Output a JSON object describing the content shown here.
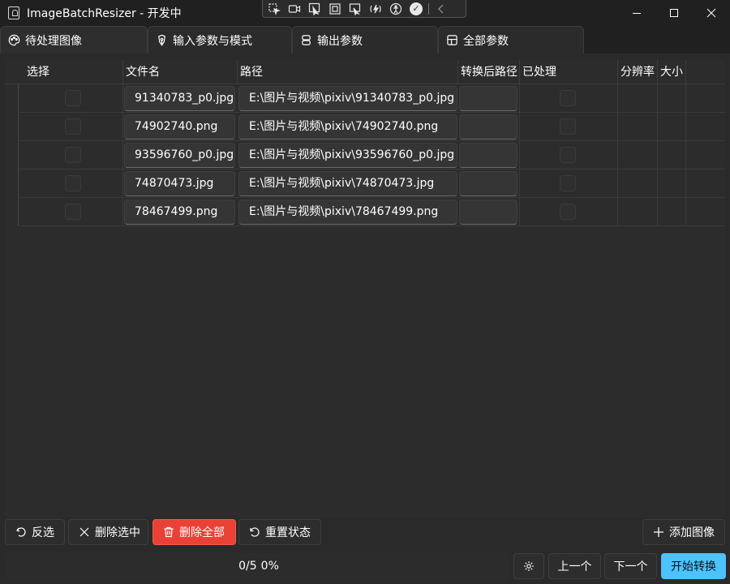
{
  "window": {
    "title": "ImageBatchResizer - 开发中",
    "app_icon": "document-icon",
    "controls": [
      "minimize-icon",
      "maximize-icon",
      "close-icon"
    ]
  },
  "devbar": {
    "tools": [
      "select-element-icon",
      "record-icon",
      "pointer-icon",
      "bounds-icon",
      "preview-icon",
      "hot-reload-icon",
      "accessibility-icon",
      "check-icon",
      "chevron-left-icon"
    ]
  },
  "tabs": [
    {
      "label": "待处理图像",
      "icon": "palette-icon",
      "active": true
    },
    {
      "label": "输入参数与模式",
      "icon": "pen-icon",
      "active": false
    },
    {
      "label": "输出参数",
      "icon": "stack-icon",
      "active": false
    },
    {
      "label": "全部参数",
      "icon": "table-icon",
      "active": false
    }
  ],
  "grid": {
    "columns": [
      "选择",
      "文件名",
      "路径",
      "转换后路径",
      "已处理",
      "分辨率",
      "大小"
    ],
    "rows": [
      {
        "selected": false,
        "file": "91340783_p0.jpg",
        "path": "E:\\图片与视频\\pixiv\\91340783_p0.jpg",
        "out_path": "",
        "processed": false,
        "resolution": "",
        "size": ""
      },
      {
        "selected": false,
        "file": "74902740.png",
        "path": "E:\\图片与视频\\pixiv\\74902740.png",
        "out_path": "",
        "processed": false,
        "resolution": "",
        "size": ""
      },
      {
        "selected": false,
        "file": "93596760_p0.jpg",
        "path": "E:\\图片与视频\\pixiv\\93596760_p0.jpg",
        "out_path": "",
        "processed": false,
        "resolution": "",
        "size": ""
      },
      {
        "selected": false,
        "file": "74870473.jpg",
        "path": "E:\\图片与视频\\pixiv\\74870473.jpg",
        "out_path": "",
        "processed": false,
        "resolution": "",
        "size": ""
      },
      {
        "selected": false,
        "file": "78467499.png",
        "path": "E:\\图片与视频\\pixiv\\78467499.png",
        "out_path": "",
        "processed": false,
        "resolution": "",
        "size": ""
      }
    ]
  },
  "actions": {
    "invert": {
      "label": "反选",
      "icon": "undo-icon"
    },
    "delete_selected": {
      "label": "删除选中",
      "icon": "close-icon"
    },
    "delete_all": {
      "label": "删除全部",
      "icon": "trash-icon"
    },
    "reset_status": {
      "label": "重置状态",
      "icon": "reset-icon"
    },
    "add_images": {
      "label": "添加图像",
      "icon": "plus-icon"
    }
  },
  "status": {
    "count": "0/5",
    "percent": "0%",
    "progress_fraction": 0,
    "settings_icon": "gear-icon",
    "prev_label": "上一个",
    "next_label": "下一个",
    "start_label": "开始转换"
  },
  "colors": {
    "accent": "#4cc2ff",
    "danger": "#ea4136",
    "background": "#202020"
  }
}
